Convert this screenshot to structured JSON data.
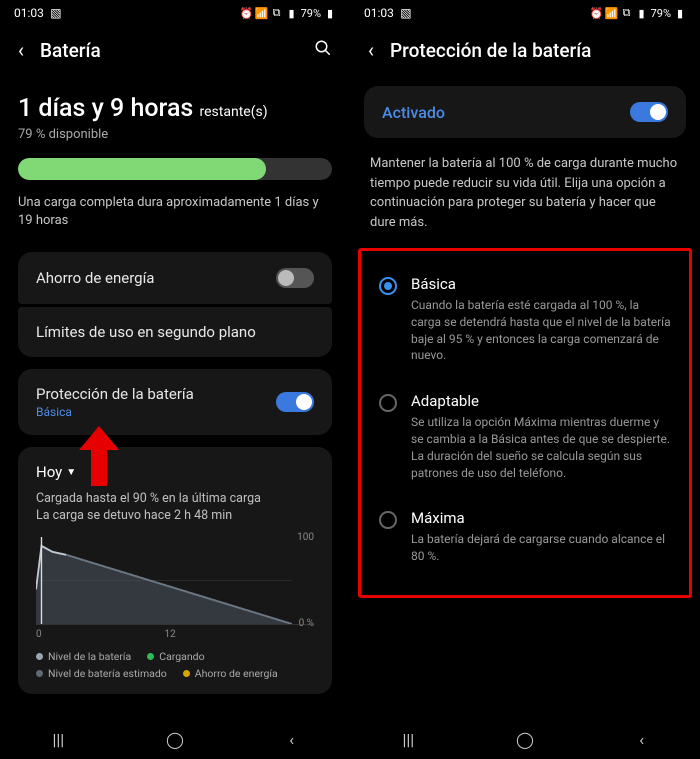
{
  "status": {
    "time": "01:03",
    "battery_text": "79%"
  },
  "left": {
    "title": "Batería",
    "remaining_main": "1 días y 9 horas",
    "remaining_suffix": "restante(s)",
    "available": "79 % disponible",
    "full_charge_info": "Una carga completa dura aproximadamente 1 días y 19 horas",
    "power_saving": "Ahorro de energía",
    "bg_limits": "Límites de uso en segundo plano",
    "protection_title": "Protección de la batería",
    "protection_mode": "Básica",
    "today": "Hoy",
    "charged_info": "Cargada hasta el 90 % en la última carga",
    "stopped_info": "La carga se detuvo hace 2 h 48 min",
    "legend": {
      "level": "Nivel de la batería",
      "charging": "Cargando",
      "estimated": "Nivel de batería estimado",
      "saving": "Ahorro de energía"
    },
    "x0": "0",
    "x12": "12",
    "y100": "100",
    "y0": "0 %"
  },
  "right": {
    "title": "Protección de la batería",
    "activated": "Activado",
    "description": "Mantener la batería al 100 % de carga durante mucho tiempo puede reducir su vida útil. Elija una opción a continuación para proteger su batería y hacer que dure más.",
    "options": [
      {
        "title": "Básica",
        "desc": "Cuando la batería esté cargada al 100 %, la carga se detendrá hasta que el nivel de la batería baje al 95 % y entonces la carga comenzará de nuevo.",
        "selected": true
      },
      {
        "title": "Adaptable",
        "desc": "Se utiliza la opción Máxima mientras duerme y se cambia a la Básica antes de que se despierte. La duración del sueño se calcula según sus patrones de uso del teléfono.",
        "selected": false
      },
      {
        "title": "Máxima",
        "desc": "La batería dejará de cargarse cuando alcance el 80 %.",
        "selected": false
      }
    ]
  },
  "chart_data": {
    "type": "area",
    "title": "Hoy",
    "xlabel": "",
    "ylabel": "%",
    "xlim": [
      0,
      24
    ],
    "ylim": [
      0,
      100
    ],
    "series": [
      {
        "name": "Nivel de la batería",
        "x": [
          0,
          0.5,
          1.5,
          2.8
        ],
        "values": [
          40,
          90,
          83,
          79
        ],
        "color": "#9aa7b3"
      },
      {
        "name": "Nivel de batería estimado",
        "x": [
          2.8,
          24
        ],
        "values": [
          79,
          0
        ],
        "color": "#5e6a75"
      }
    ],
    "legend_extra": [
      "Cargando",
      "Ahorro de energía"
    ]
  }
}
